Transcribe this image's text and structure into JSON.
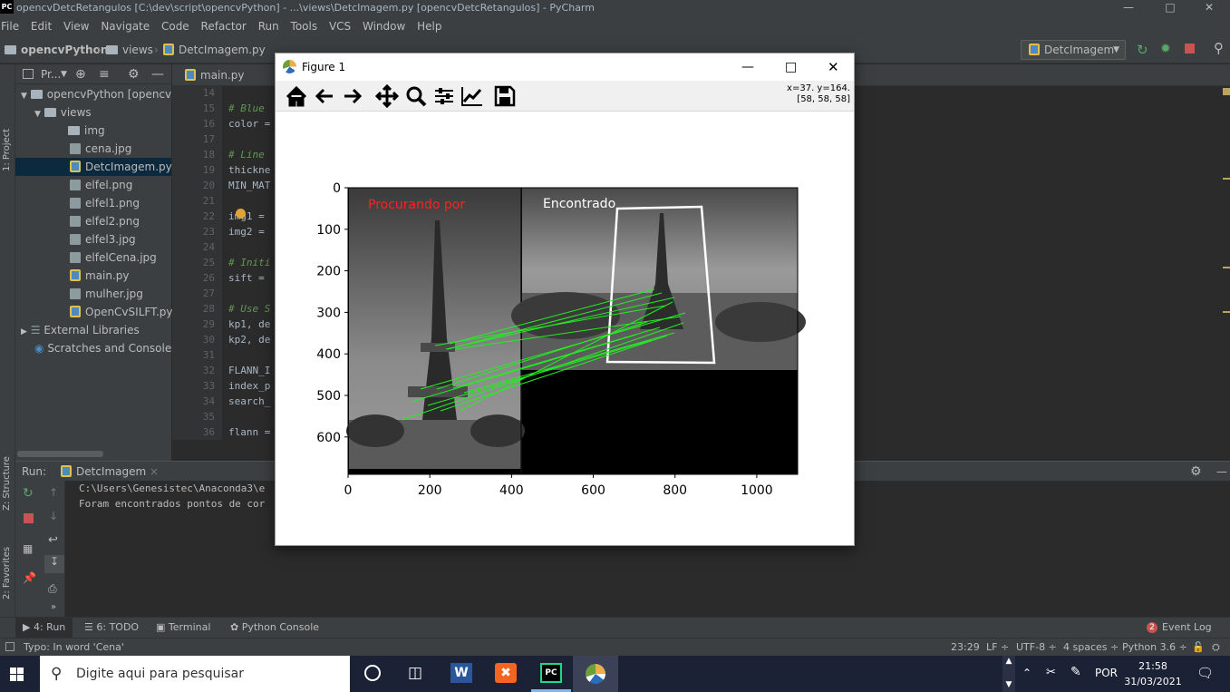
{
  "titlebar": {
    "logo": "PC",
    "title": "opencvDetcRetangulos [C:\\dev\\script\\opencvPython] - ...\\views\\DetcImagem.py [opencvDetcRetangulos] - PyCharm"
  },
  "menu": [
    "File",
    "Edit",
    "View",
    "Navigate",
    "Code",
    "Refactor",
    "Run",
    "Tools",
    "VCS",
    "Window",
    "Help"
  ],
  "breadcrumb": {
    "project": "opencvPython",
    "folder": "views",
    "file": "DetcImagem.py"
  },
  "run_config": "DetcImagem",
  "left_strip": {
    "project": "1: Project",
    "structure": "Z: Structure",
    "favorites": "2: Favorites"
  },
  "project_panel": {
    "title": "Pr...",
    "root": "opencvPython [opencvD",
    "views": "views",
    "files": [
      "img",
      "cena.jpg",
      "DetcImagem.py",
      "elfel.png",
      "elfel1.png",
      "elfel2.png",
      "elfel3.jpg",
      "elfelCena.jpg",
      "main.py",
      "mulher.jpg",
      "OpenCvSILFT.py"
    ],
    "external": "External Libraries",
    "scratches": "Scratches and Consoles"
  },
  "editor_tab": "main.py",
  "code": {
    "lines": [
      {
        "n": "14",
        "t": ""
      },
      {
        "n": "15",
        "t": "# Blue",
        "c": true
      },
      {
        "n": "16",
        "t": "color ="
      },
      {
        "n": "17",
        "t": ""
      },
      {
        "n": "18",
        "t": "# Line",
        "c": true
      },
      {
        "n": "19",
        "t": "thickne"
      },
      {
        "n": "20",
        "t": "MIN_MAT"
      },
      {
        "n": "21",
        "t": ""
      },
      {
        "n": "22",
        "t": "img1 ="
      },
      {
        "n": "23",
        "t": "img2 ="
      },
      {
        "n": "24",
        "t": ""
      },
      {
        "n": "25",
        "t": "# Initi",
        "c": true
      },
      {
        "n": "26",
        "t": "sift ="
      },
      {
        "n": "27",
        "t": ""
      },
      {
        "n": "28",
        "t": "# Use S",
        "c": true
      },
      {
        "n": "29",
        "t": "kp1, de"
      },
      {
        "n": "30",
        "t": "kp2, de"
      },
      {
        "n": "31",
        "t": ""
      },
      {
        "n": "32",
        "t": "FLANN_I"
      },
      {
        "n": "33",
        "t": "index_p"
      },
      {
        "n": "34",
        "t": "search_"
      },
      {
        "n": "35",
        "t": ""
      },
      {
        "n": "36",
        "t": "flann ="
      }
    ]
  },
  "run_panel": {
    "label": "Run:",
    "tab": "DetcImagem",
    "console": [
      "C:\\Users\\Genesistec\\Anaconda3\\e",
      "Foram encontrados pontos de cor"
    ]
  },
  "toolwindows": {
    "run": "4: Run",
    "todo": "6: TODO",
    "terminal": "Terminal",
    "python_console": "Python Console",
    "event_count": "2",
    "event_log": "Event Log"
  },
  "status": {
    "message": "Typo: In word 'Cena'",
    "position": "23:29",
    "line_sep": "LF ÷",
    "encoding": "UTF-8 ÷",
    "indent": "4 spaces ÷",
    "interpreter": "Python 3.6 ÷"
  },
  "taskbar": {
    "search_placeholder": "Digite aqui para pesquisar",
    "lang": "POR",
    "time": "21:58",
    "date": "31/03/2021"
  },
  "figure": {
    "title": "Figure 1",
    "coords_line1": "x=37. y=164.",
    "coords_line2": "[58, 58, 58]",
    "left_label": "Procurando por",
    "right_label": "Encontrado",
    "y_ticks": [
      "0",
      "100",
      "200",
      "300",
      "400",
      "500",
      "600"
    ],
    "x_ticks": [
      "0",
      "200",
      "400",
      "600",
      "800",
      "1000"
    ],
    "xlim": [
      0,
      1100
    ],
    "ylim": [
      690,
      0
    ]
  },
  "colors": {
    "match_lines": "#22ee22",
    "left_label": "#ff2020",
    "ide_bg": "#2b2b2b",
    "panel": "#3c3f41",
    "selection": "#0d293e",
    "comment": "#629755"
  }
}
